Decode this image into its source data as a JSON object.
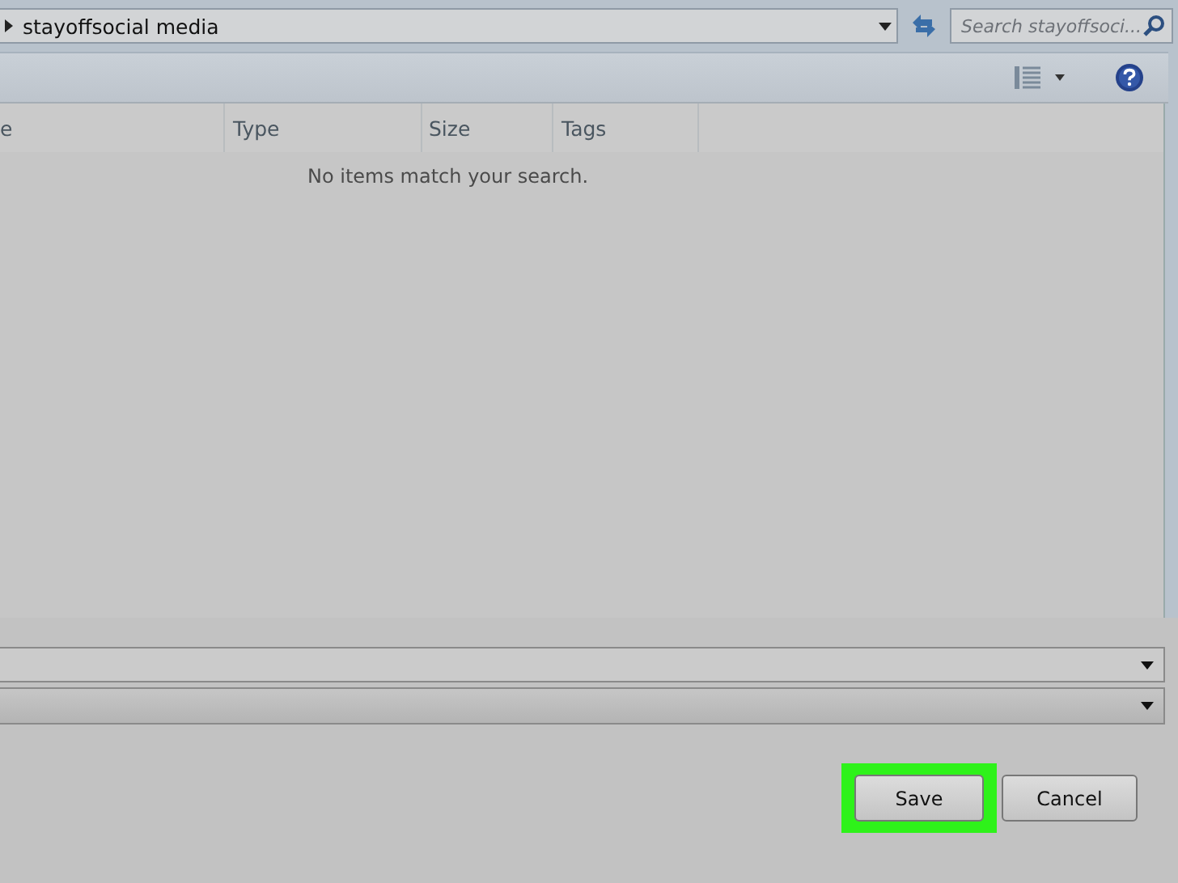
{
  "address_bar": {
    "path": "stayoffsocial media"
  },
  "search": {
    "placeholder": "Search stayoffsoci..."
  },
  "table": {
    "columns": [
      {
        "label": "e"
      },
      {
        "label": "Type"
      },
      {
        "label": "Size"
      },
      {
        "label": "Tags"
      }
    ],
    "empty_message": "No items match your search."
  },
  "buttons": [
    {
      "label": "Save",
      "highlighted": true
    },
    {
      "label": "Cancel",
      "highlighted": false
    }
  ]
}
